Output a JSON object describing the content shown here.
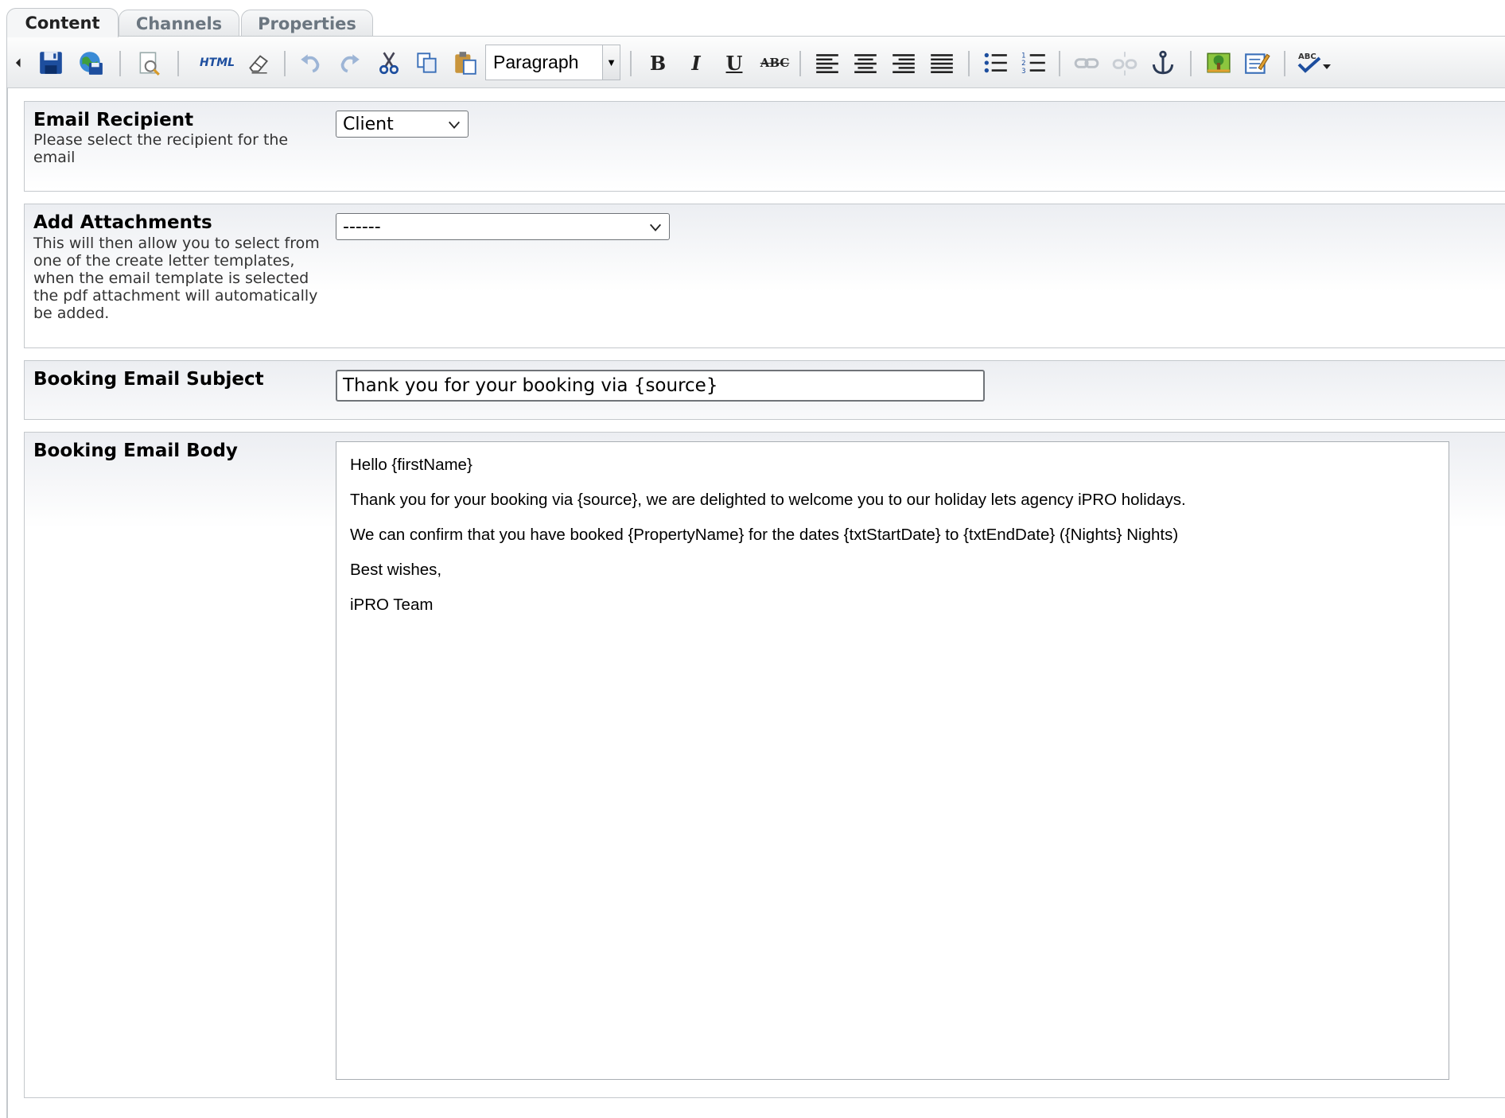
{
  "tabs": [
    {
      "label": "Content",
      "active": true
    },
    {
      "label": "Channels",
      "active": false
    },
    {
      "label": "Properties",
      "active": false
    }
  ],
  "toolbar": {
    "collapse_icon": "triangle-left-icon",
    "html_label": "HTML",
    "bold_label": "B",
    "italic_label": "I",
    "underline_label": "U",
    "strike_label": "ABC",
    "format_select": {
      "value": "Paragraph"
    }
  },
  "form": {
    "recipient": {
      "title": "Email Recipient",
      "description": "Please select the recipient for the email",
      "value": "Client"
    },
    "attachments": {
      "title": "Add Attachments",
      "description": "This will then allow you to select from one of the create letter templates, when the email template is selected the pdf attachment will automatically be added.",
      "value": "------"
    },
    "subject": {
      "title": "Booking Email Subject",
      "value": "Thank you for your booking via {source}"
    },
    "body": {
      "title": "Booking Email Body",
      "paragraphs": [
        "Hello {firstName}",
        "Thank you for your booking via {source}, we are delighted to welcome you to our holiday lets agency iPRO holidays.",
        "We can confirm that you have booked {PropertyName} for the dates {txtStartDate} to {txtEndDate} ({Nights} Nights)",
        "Best wishes,",
        "iPRO Team"
      ]
    }
  },
  "colors": {
    "tab_text": "#6b7680",
    "panel_border": "#c4c8cc",
    "panel_gradient_top": "#eceef2"
  }
}
